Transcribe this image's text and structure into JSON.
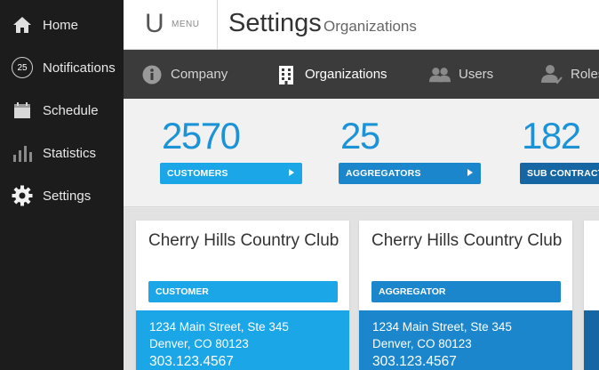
{
  "sidebar": {
    "items": [
      {
        "label": "Home",
        "icon": "home-icon"
      },
      {
        "label": "Notifications",
        "icon": "notification-badge",
        "badge": "25"
      },
      {
        "label": "Schedule",
        "icon": "calendar-icon"
      },
      {
        "label": "Statistics",
        "icon": "bar-chart-icon"
      },
      {
        "label": "Settings",
        "icon": "gear-icon"
      }
    ]
  },
  "header": {
    "logo_letter": "U",
    "menu_label": "MENU",
    "title": "Settings",
    "subtitle": "Organizations"
  },
  "tabs": [
    {
      "label": "Company",
      "icon": "info-icon"
    },
    {
      "label": "Organizations",
      "icon": "building-icon",
      "active": true
    },
    {
      "label": "Users",
      "icon": "users-icon"
    },
    {
      "label": "Roles",
      "icon": "user-check-icon"
    }
  ],
  "stats": [
    {
      "value": "2570",
      "label": "CUSTOMERS",
      "color": "#1ba6e8"
    },
    {
      "value": "25",
      "label": "AGGREGATORS",
      "color": "#1c86cc"
    },
    {
      "value": "182",
      "label": "SUB CONTRACTORS",
      "color": "#1566a3"
    }
  ],
  "cards": [
    {
      "name": "Cherry Hills Country Club",
      "tag": "CUSTOMER",
      "tag_color": "#1ba6e8",
      "footer_color": "#1ba6e8",
      "address_line1": "1234 Main Street, Ste 345",
      "address_line2": "Denver, CO 80123",
      "phone": "303.123.4567"
    },
    {
      "name": "Cherry Hills Country Club",
      "tag": "AGGREGATOR",
      "tag_color": "#1c86cc",
      "footer_color": "#1c86cc",
      "address_line1": "1234 Main Street, Ste 345",
      "address_line2": "Denver, CO 80123",
      "phone": "303.123.4567"
    }
  ],
  "colors": {
    "sidebar_bg": "#1c1c1c",
    "tabbar_bg": "#3b3b3b",
    "accent": "#1c93d6"
  }
}
